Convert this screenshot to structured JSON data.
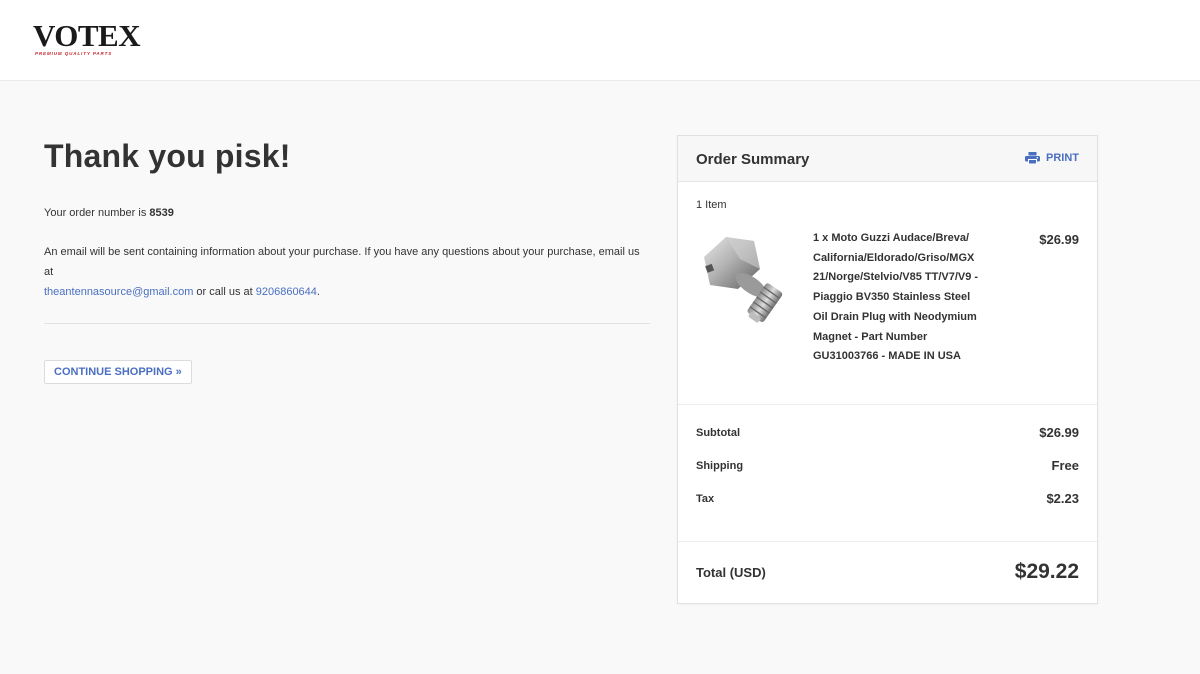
{
  "brand": {
    "name": "VOTEX",
    "tagline": "PREMIUM QUALITY PARTS",
    "accent_color": "#c8262c"
  },
  "confirmation": {
    "heading": "Thank you pisk!",
    "order_prefix": "Your order number is",
    "order_number": "8539",
    "info_text": "An email will be sent containing information about your purchase. If you have any questions about your purchase, email us at",
    "email": "theantennasource@gmail.com",
    "call_text": "or call us at",
    "phone": "9206860644",
    "continue_label": "CONTINUE SHOPPING »"
  },
  "summary": {
    "title": "Order Summary",
    "print_label": "PRINT",
    "items_count": "1 Item",
    "items": [
      {
        "title": "1 x Moto Guzzi Audace/Breva/ California/Eldorado/Griso/MGX 21/Norge/Stelvio/V85 TT/V7/V9 - Piaggio BV350 Stainless Steel Oil Drain Plug with Neodymium Magnet - Part Number GU31003766 - MADE IN USA",
        "price": "$26.99",
        "image_icon": "oil-drain-plug-image"
      }
    ],
    "subtotal_label": "Subtotal",
    "subtotal": "$26.99",
    "shipping_label": "Shipping",
    "shipping": "Free",
    "tax_label": "Tax",
    "tax": "$2.23",
    "total_label": "Total (USD)",
    "total": "$29.22"
  },
  "colors": {
    "link": "#4a6fc1",
    "text": "#333333",
    "background": "#f9f9f9"
  }
}
